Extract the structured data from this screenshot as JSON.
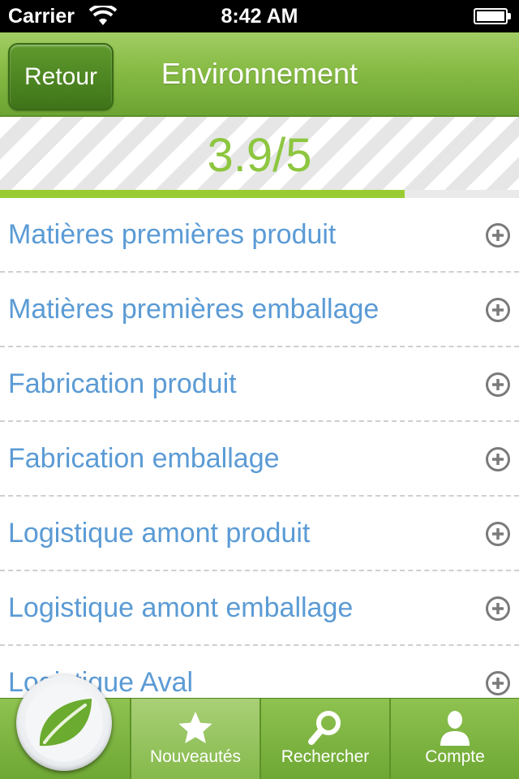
{
  "status_bar": {
    "carrier": "Carrier",
    "time": "8:42 AM"
  },
  "nav": {
    "back_label": "Retour",
    "title": "Environnement"
  },
  "score": {
    "value_text": "3.9/5",
    "progress_fraction": 0.78,
    "color": "#8dc63f"
  },
  "criteria": {
    "items": [
      {
        "label": "Matières premières produit",
        "icon": "plus-circle-icon"
      },
      {
        "label": "Matières premières emballage",
        "icon": "plus-circle-icon"
      },
      {
        "label": "Fabrication produit",
        "icon": "plus-circle-icon"
      },
      {
        "label": "Fabrication emballage",
        "icon": "plus-circle-icon"
      },
      {
        "label": "Logistique amont produit",
        "icon": "plus-circle-icon"
      },
      {
        "label": "Logistique amont emballage",
        "icon": "plus-circle-icon"
      },
      {
        "label": "Logistique Aval",
        "icon": "plus-circle-icon"
      }
    ]
  },
  "tab_bar": {
    "logo_icon": "leaf-icon",
    "tabs": [
      {
        "label": "Nouveautés",
        "icon": "star-icon",
        "active": true
      },
      {
        "label": "Rechercher",
        "icon": "search-icon",
        "active": false
      },
      {
        "label": "Compte",
        "icon": "user-icon",
        "active": false
      }
    ]
  },
  "colors": {
    "accent_green": "#8dc63f",
    "link_blue": "#5b9bd5"
  }
}
